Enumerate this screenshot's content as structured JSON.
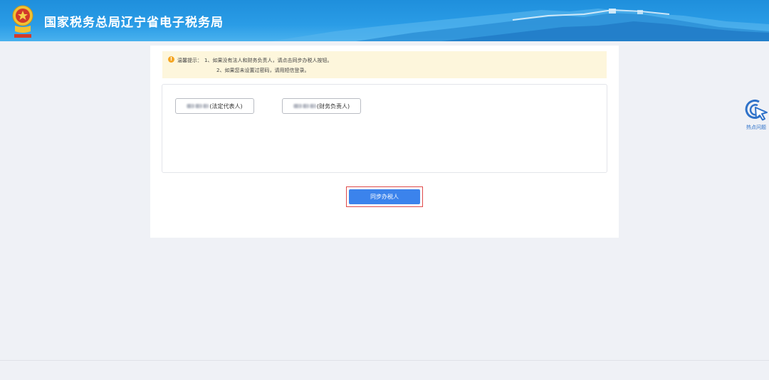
{
  "header": {
    "site_title": "国家税务总局辽宁省电子税务局",
    "emblem_icon": "tax-bureau-emblem",
    "colors": {
      "bar": "#2a9ce6",
      "mountains": "#3da6e8"
    }
  },
  "notice": {
    "icon": "warning-circle-icon",
    "label": "温馨提示：",
    "line1": "1、如果没有法人和财务负责人，请点击同步办税人按钮。",
    "line2": "2、如果您未设置过密码，请用短信登录。",
    "background": "#fdf6dc"
  },
  "persons": [
    {
      "suffix": "(法定代表人)"
    },
    {
      "suffix": "(财务负责人)"
    }
  ],
  "sync_button": {
    "label": "同步办税人",
    "color": "#3b83ec",
    "highlight": "#e04a4a"
  },
  "side": {
    "hot_label": "热点问题",
    "icon": "cursor-click-icon"
  }
}
